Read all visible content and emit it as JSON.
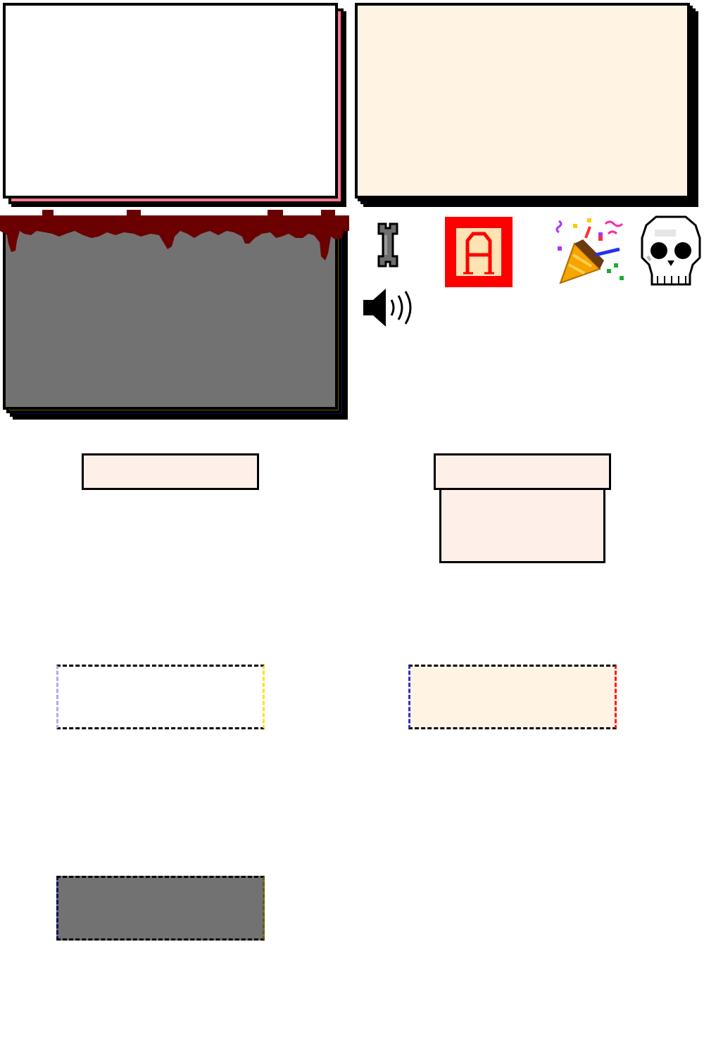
{
  "colors": {
    "outline": "#000000",
    "panel_white": "#ffffff",
    "panel_cream": "#fff3e3",
    "panel_gray": "#727272",
    "edge_pink": "#ff7a8a",
    "edge_lilac": "#b7a6f0",
    "edge_yellow": "#ffe21a",
    "edge_red": "#ff1a1a",
    "edge_blue": "#2a33d6",
    "edge_olive": "#6b5a00",
    "edge_navy": "#0a0f5c",
    "edge_maroon": "#3a0010",
    "blood": "#6b0000",
    "pink_box": "#ffefe9",
    "bone": "#6e6e6e",
    "letter_red": "#ff0000",
    "letter_bg": "#ffe3b3"
  },
  "icons": {
    "bone": "bone-icon",
    "letter": "letter-a-icon",
    "party": "party-popper-icon",
    "skull": "skull-icon",
    "speaker": "speaker-icon"
  },
  "letter_tile": {
    "glyph": "A"
  }
}
